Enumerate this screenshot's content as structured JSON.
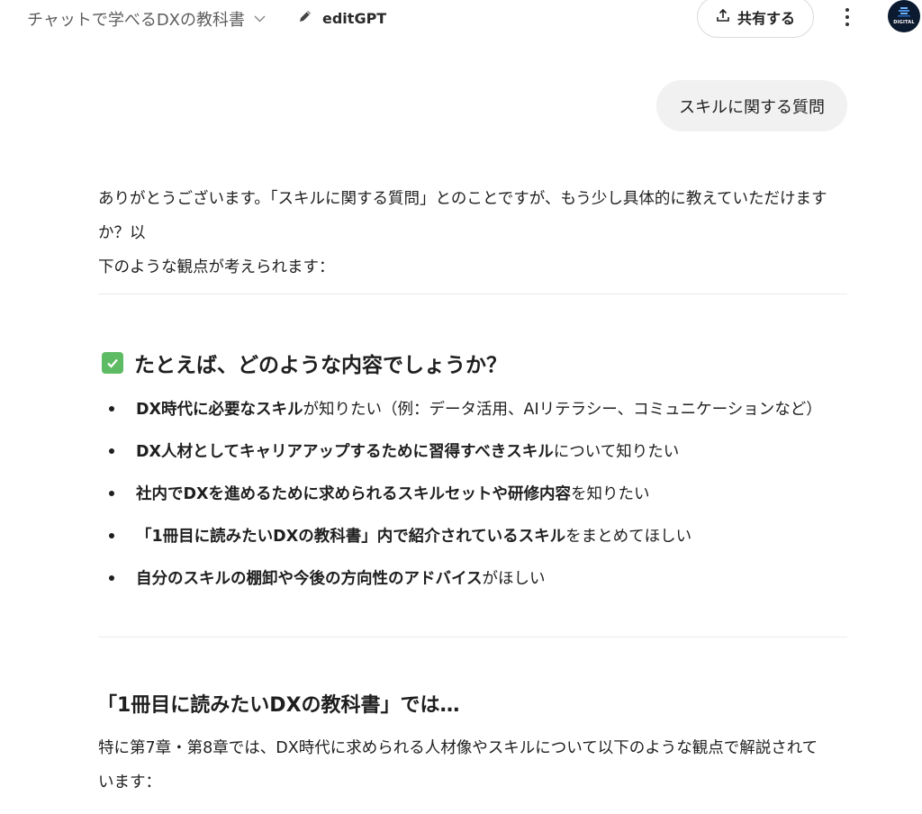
{
  "header": {
    "gpt_title": "チャットで学べるDXの教科書",
    "edit_gpt_label": "editGPT",
    "share_label": "共有する",
    "avatar_text": "DIGITAL"
  },
  "icons": {
    "title_dropdown": "chevron-down-icon",
    "edit": "pencil-icon",
    "share": "share-upload-icon",
    "more": "more-vertical-icon",
    "checkmark": "check-box-icon"
  },
  "colors": {
    "user_bubble_bg": "#f1f1f1",
    "check_green": "#5dbb63",
    "avatar_bg": "#0b1a2e"
  },
  "conversation": {
    "user_message": "スキルに関する質問",
    "intro_line1": "ありがとうございます。「スキルに関する質問」とのことですが、もう少し具体的に教えていただけますか？以",
    "intro_line2": "下のような観点が考えられます：",
    "section1_heading": "たとえば、どのような内容でしょうか？",
    "bullets": [
      {
        "bold": "DX時代に必要なスキル",
        "rest": "が知りたい（例：データ活用、AIリテラシー、コミュニケーションなど）"
      },
      {
        "bold": "DX人材としてキャリアアップするために習得すべきスキル",
        "rest": "について知りたい"
      },
      {
        "bold": "社内でDXを進めるために求められるスキルセットや研修内容",
        "rest": "を知りたい"
      },
      {
        "bold": "「1冊目に読みたいDXの教科書」内で紹介されているスキル",
        "rest": "をまとめてほしい"
      },
      {
        "bold": "自分のスキルの棚卸や今後の方向性のアドバイス",
        "rest": "がほしい"
      }
    ],
    "section2_heading": "「1冊目に読みたいDXの教科書」では…",
    "section2_line1": "特に第7章・第8章では、DX時代に求められる人材像やスキルについて以下のような観点で解説されて",
    "section2_line2": "います："
  }
}
